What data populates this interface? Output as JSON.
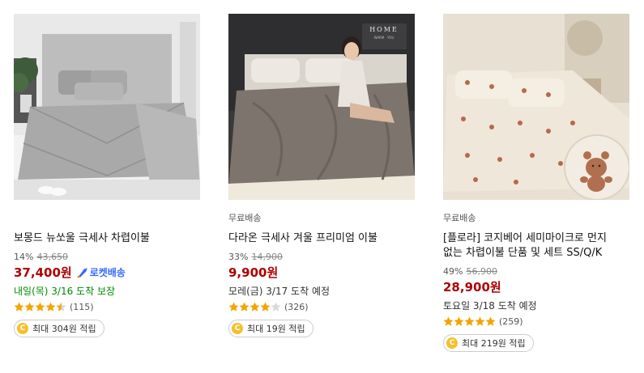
{
  "products": [
    {
      "title": "보몽드 뉴쏘울 극세사 차렵이불",
      "free_shipping": "",
      "discount_rate": "14%",
      "original_price": "43,650",
      "price": "37,400원",
      "rocket_label": "로켓배송",
      "delivery": "내일(목) 3/16 도착 보장",
      "rating": 4.5,
      "review_count": "(115)",
      "reward": "최대 304원 적립"
    },
    {
      "title": "다라온 극세사 겨울 프리미엄 이불",
      "free_shipping": "무료배송",
      "discount_rate": "33%",
      "original_price": "14,900",
      "price": "9,900원",
      "rocket_label": "",
      "delivery": "모레(금) 3/17 도착 예정",
      "rating": 4,
      "review_count": "(326)",
      "reward": "최대 19원 적립"
    },
    {
      "title_line1": "[플로라] 코지베어 세미마이크로 먼지",
      "title_line2": "없는 차렵이불 단품 및 세트 SS/Q/K",
      "free_shipping": "무료배송",
      "discount_rate": "49%",
      "original_price": "56,900",
      "price": "28,900원",
      "rocket_label": "",
      "delivery": "토요일 3/18 도착 예정",
      "rating": 5,
      "review_count": "(259)",
      "reward": "최대 219원 적립"
    }
  ],
  "image_text": {
    "home_sign_title": "HOME",
    "home_sign_sub": "WARM · YOU"
  },
  "coin_symbol": "C",
  "colors": {
    "price": "#ae0000",
    "rocket": "#346aff",
    "delivery_green": "#008c00",
    "star": "#f5a300"
  }
}
